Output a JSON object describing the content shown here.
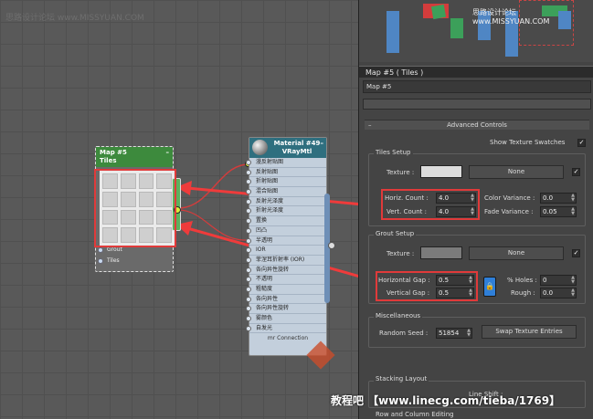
{
  "canvas": {
    "watermark": "思路设计论坛 www.MISSYUAN.COM",
    "tiles_node": {
      "title": "Map #5",
      "subtitle": "Tiles",
      "close": "–",
      "slots": [
        "Grout",
        "Tiles"
      ]
    },
    "material_node": {
      "title": "Material #49",
      "subtitle": "VRayMtl",
      "close": "–",
      "slots": [
        "漫反射贴图",
        "反射贴图",
        "折射贴图",
        "混合贴图",
        "反射光泽度",
        "折射光泽度",
        "置换",
        "凹凸",
        "半透明",
        "IOR",
        "菲涅耳折射率 (IOR)",
        "各向异性旋转",
        "不透明",
        "粗糙度",
        "各向异性",
        "各向异性旋转",
        "雾颜色",
        "自发光"
      ],
      "footer": "mr Connection"
    }
  },
  "panel": {
    "preview_watermark": "思路设计论坛 www.MISSYUAN.COM",
    "title": "Map #5  ( Tiles )",
    "map_name": "Map #5",
    "advanced": {
      "header": "Advanced Controls",
      "show_swatches_label": "Show Texture Swatches",
      "show_swatches": "✓"
    },
    "tiles_setup": {
      "group": "Tiles Setup",
      "texture_label": "Texture :",
      "texture_btn": "None",
      "texture_check": "✓",
      "horiz_label": "Horiz. Count :",
      "horiz_value": "4.0",
      "vert_label": "Vert. Count :",
      "vert_value": "4.0",
      "color_var_label": "Color Variance :",
      "color_var_value": "0.0",
      "fade_var_label": "Fade Variance :",
      "fade_var_value": "0.05"
    },
    "grout_setup": {
      "group": "Grout Setup",
      "texture_label": "Texture :",
      "texture_btn": "None",
      "texture_check": "✓",
      "hgap_label": "Horizontal Gap :",
      "hgap_value": "0.5",
      "vgap_label": "Vertical Gap :",
      "vgap_value": "0.5",
      "lock_icon": "lock-icon",
      "holes_label": "% Holes :",
      "holes_value": "0",
      "rough_label": "Rough :",
      "rough_value": "0.0"
    },
    "misc": {
      "group": "Miscellaneous",
      "seed_label": "Random Seed :",
      "seed_value": "51854",
      "swap_btn": "Swap Texture Entries"
    },
    "stacking": {
      "group": "Stacking Layout",
      "line_shift_label": "Line Shift :"
    },
    "row_col": {
      "group": "Row and Column Editing"
    }
  },
  "bottom_watermark": "教程吧 【www.linecg.com/tieba/1769】",
  "colors": {
    "tiles_header": "#3d8a3d",
    "material_header": "#2f6f7f",
    "highlight": "#e03a3a",
    "wire": "#d33c3c"
  }
}
